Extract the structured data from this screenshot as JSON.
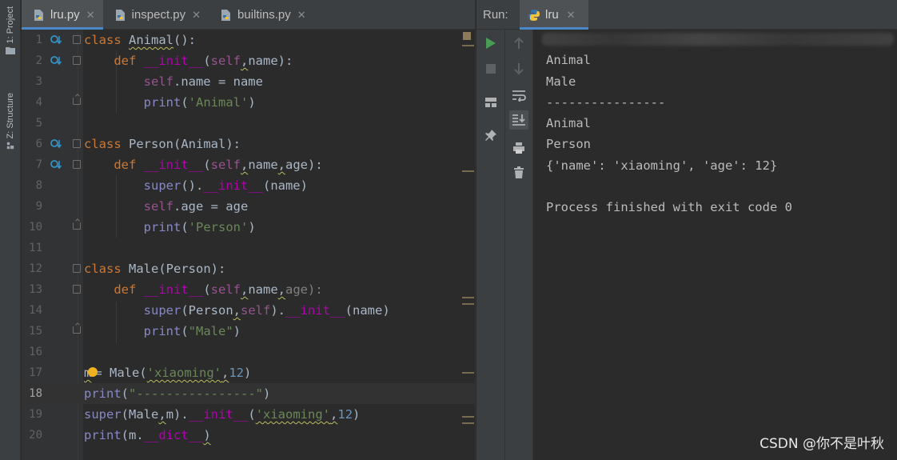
{
  "sidebar": {
    "project_label": "1: Project",
    "structure_label": "Z: Structure"
  },
  "editor": {
    "tabs": [
      {
        "label": "lru.py",
        "active": true
      },
      {
        "label": "inspect.py",
        "active": false
      },
      {
        "label": "builtins.py",
        "active": false
      }
    ],
    "current_line": 18,
    "line_numbers": [
      "1",
      "2",
      "3",
      "4",
      "5",
      "6",
      "7",
      "8",
      "9",
      "10",
      "11",
      "12",
      "13",
      "14",
      "15",
      "16",
      "17",
      "18",
      "19",
      "20"
    ]
  },
  "code_lines": {
    "l1": {
      "a": "class ",
      "b": "Animal",
      "c": "():"
    },
    "l2": {
      "indent": "    ",
      "def": "def ",
      "fn": "__init__",
      "p1": "(",
      "self": "self",
      "c1": ",",
      "p2": "name):"
    },
    "l3": {
      "indent": "        ",
      "self": "self",
      "rest": ".name = name"
    },
    "l4": {
      "indent": "        ",
      "fn": "print",
      "p1": "(",
      "s": "'Animal'",
      "p2": ")"
    },
    "l6": {
      "a": "class ",
      "b": "Person(Animal):"
    },
    "l7": {
      "indent": "    ",
      "def": "def ",
      "fn": "__init__",
      "p1": "(",
      "self": "self",
      "c1": ",",
      "n": "name",
      "c2": ",",
      "p2": "age):"
    },
    "l8": {
      "indent": "        ",
      "fn": "super",
      "p1": "().",
      "m": "__init__",
      "p2": "(name)"
    },
    "l9": {
      "indent": "        ",
      "self": "self",
      "rest": ".age = age"
    },
    "l10": {
      "indent": "        ",
      "fn": "print",
      "p1": "(",
      "s": "'Person'",
      "p2": ")"
    },
    "l12": {
      "a": "class ",
      "b": "Male(Person):"
    },
    "l13": {
      "indent": "    ",
      "def": "def ",
      "fn": "__init__",
      "p1": "(",
      "self": "self",
      "c1": ",",
      "n": "name",
      "c2": ",",
      "p2": "age):"
    },
    "l14": {
      "indent": "        ",
      "fn": "super",
      "p1": "(Person",
      "c1": ",",
      "self": "self",
      "p2": ").",
      "m": "__init__",
      "p3": "(name)"
    },
    "l15": {
      "indent": "        ",
      "fn": "print",
      "p1": "(",
      "s": "\"Male\"",
      "p2": ")"
    },
    "l17": {
      "v": "m",
      "p1": "= Male(",
      "s": "'xiaoming'",
      "c1": ",",
      "n": "12",
      "p2": ")"
    },
    "l18": {
      "fn": "print",
      "p1": "(",
      "s": "\"----------------\"",
      "p2": ")"
    },
    "l19": {
      "fn": "super",
      "p1": "(Male",
      "c1": ",",
      "p2": "m).",
      "m": "__init__",
      "p3": "(",
      "s": "'xiaoming'",
      "c2": ",",
      "n": "12",
      "p4": ")"
    },
    "l20": {
      "fn": "print",
      "p1": "(m.",
      "m": "__dict__",
      "p2": ")"
    }
  },
  "run": {
    "label": "Run:",
    "tab_label": "lru",
    "output": [
      "Animal",
      "Male",
      "----------------",
      "Animal",
      "Person",
      "{'name': 'xiaoming', 'age': 12}",
      "",
      "Process finished with exit code 0"
    ]
  },
  "watermark": "CSDN @你不是叶秋",
  "colors": {
    "keyword": "#cc7832",
    "string": "#6a8759",
    "number": "#6897bb",
    "magic": "#b200b2",
    "self": "#94558d",
    "builtin": "#8888c6",
    "run_green": "#499c54"
  }
}
